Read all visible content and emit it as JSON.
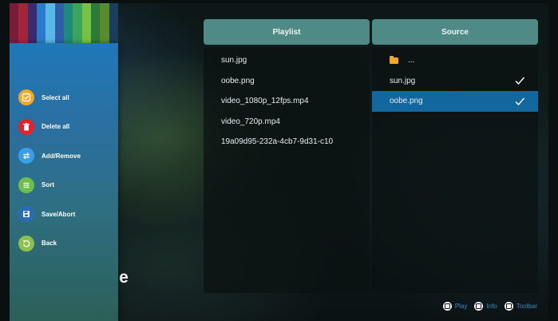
{
  "colors": {
    "stripes": [
      "#7a1b3a",
      "#a2263a",
      "#3a2a6e",
      "#2a7bc9",
      "#5bb7e8",
      "#2e5fa8",
      "#1e8a7a",
      "#3aa55c",
      "#7ac043",
      "#2c7a3a",
      "#5a8a2a",
      "#1b3e5e"
    ],
    "panel_header": "#4f8a86",
    "selected_row": "#13679f",
    "hint_label": "#3f88c4"
  },
  "sidebar": {
    "items": [
      {
        "label": "Select all",
        "icon": "select-all-icon",
        "color": "#f5a623"
      },
      {
        "label": "Delete all",
        "icon": "trash-icon",
        "color": "#e8202a"
      },
      {
        "label": "Add/Remove",
        "icon": "swap-icon",
        "color": "#3a9ee6"
      },
      {
        "label": "Sort",
        "icon": "list-icon",
        "color": "#6cc04a"
      },
      {
        "label": "Save/Abort",
        "icon": "save-icon",
        "color": "#2b6cb5"
      },
      {
        "label": "Back",
        "icon": "back-icon",
        "color": "#8bc34a"
      }
    ]
  },
  "background_text": "se",
  "playlist": {
    "title": "Playlist",
    "items": [
      "sun.jpg",
      "oobe.png",
      "video_1080p_12fps.mp4",
      "video_720p.mp4",
      "19a09d95-232a-4cb7-9d31-c10"
    ]
  },
  "source": {
    "title": "Source",
    "parent_label": "...",
    "items": [
      {
        "label": "sun.jpg",
        "checked": true,
        "selected": false
      },
      {
        "label": "oobe.png",
        "checked": true,
        "selected": true
      }
    ]
  },
  "hints": [
    {
      "label": "Play",
      "icon": "play-key-icon"
    },
    {
      "label": "Info",
      "icon": "info-key-icon"
    },
    {
      "label": "Toolbar",
      "icon": "toolbar-key-icon"
    }
  ]
}
